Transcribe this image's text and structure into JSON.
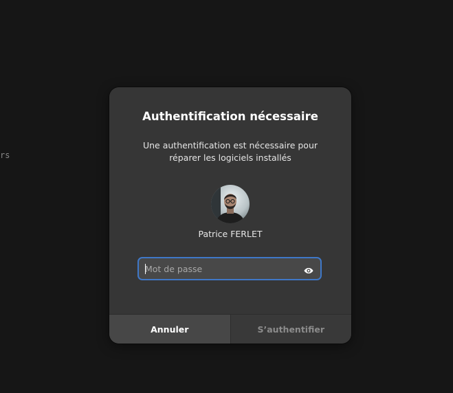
{
  "background": {
    "fragment_text": "rs"
  },
  "dialog": {
    "title": "Authentification nécessaire",
    "description_line1": "Une authentification est nécessaire pour",
    "description_line2": "réparer les logiciels installés",
    "user_name": "Patrice FERLET",
    "password": {
      "placeholder": "Mot de passe",
      "value": "",
      "reveal_icon": "eye-icon"
    },
    "buttons": {
      "cancel_label": "Annuler",
      "authenticate_label": "S’authentifier"
    }
  },
  "colors": {
    "focus_ring": "#3f78c8",
    "dialog_bg": "#363636",
    "desktop_bg": "#161616"
  }
}
